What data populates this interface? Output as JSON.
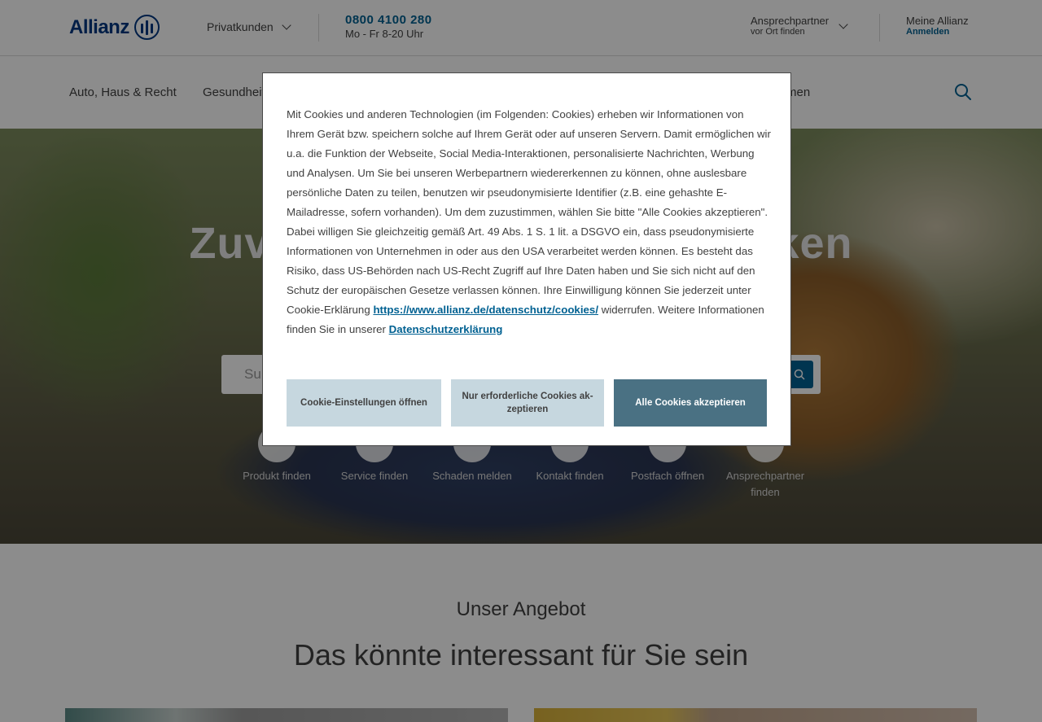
{
  "header": {
    "logo_text": "Allianz",
    "segment_label": "Privatkunden",
    "phone_number": "0800 4100 280",
    "phone_hours": "Mo - Fr 8-20 Uhr",
    "contact_title": "Ansprechpartner",
    "contact_subtitle": "vor Ort finden",
    "account_title": "Meine Allianz",
    "account_login": "Anmelden"
  },
  "nav": {
    "items": [
      "Auto, Haus & Recht",
      "Gesundheit",
      "men"
    ]
  },
  "hero": {
    "title_left": "Zuv",
    "title_right": "ken",
    "search_placeholder": "Su",
    "quick_links": [
      "Produkt finden",
      "Service finden",
      "Schaden melden",
      "Kontakt finden",
      "Postfach öffnen",
      "Ansprechpartner finden"
    ]
  },
  "offers": {
    "subtitle": "Unser Angebot",
    "title": "Das könnte interessant für Sie sein"
  },
  "cookie_modal": {
    "text_before_link1": "Mit Cookies und anderen Technologien (im Folgenden: Cookies) erheben wir Informationen von Ihrem Gerät bzw. speichern solche auf Ihrem Gerät oder auf unseren Servern. Damit ermöglichen wir u.a. die Funktion der Webseite, Social Media-Interaktionen, personalisierte Nachrichten, Werbung und Analysen. Um Sie bei unseren Werbepartnern wiedererkennen zu können, ohne auslesbare persönliche Daten zu teilen, benutzen wir pseudonymisierte Identifier (z.B. eine gehashte E-Mailadresse, sofern vorhanden). Um dem zuzustimmen, wählen Sie bitte \"Alle Cookies akzeptieren\". Dabei willigen Sie gleichzeitig gemäß Art. 49 Abs. 1 S. 1 lit. a DSGVO ein, dass pseudonymisierte Informationen von Unternehmen in oder aus den USA verarbeitet werden können. Es besteht das Risiko, dass US-Behörden nach US-Recht Zugriff auf Ihre Daten haben und Sie sich nicht auf den Schutz der europäischen Gesetze verlassen können. Ihre Einwilligung können Sie jederzeit unter Cookie-Erklärung",
    "link1": "https://www.allianz.de/datenschutz/cookies/",
    "text_between": " widerrufen. Weitere Informationen finden Sie in unserer ",
    "link2": "Datenschutzerklärung",
    "btn_settings": "Cookie-Einstellungen öffnen",
    "btn_required": "Nur erforderliche Cookies ak-zeptieren",
    "btn_accept_all": "Alle Cookies akzeptieren"
  },
  "colors": {
    "brand": "#003781",
    "link": "#006192",
    "accept_button": "#4a7183",
    "secondary_button": "#c6d7df"
  }
}
